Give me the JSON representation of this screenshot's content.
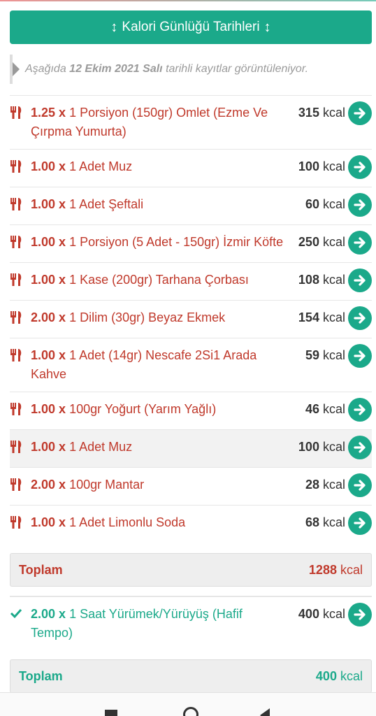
{
  "header": {
    "button_label": "Kalori Günlüğü Tarihleri",
    "arrow_glyph": "↕"
  },
  "notice": {
    "prefix": "Aşağıda",
    "date": "12 Ekim 2021 Salı",
    "suffix": "tarihli kayıtlar görüntüleniyor."
  },
  "foods": [
    {
      "qty": "1.25 x",
      "desc": "1 Porsiyon (150gr) Omlet (Ezme Ve Çırpma Yumurta)",
      "kcal": "315",
      "unit": "kcal"
    },
    {
      "qty": "1.00 x",
      "desc": "1 Adet Muz",
      "kcal": "100",
      "unit": "kcal"
    },
    {
      "qty": "1.00 x",
      "desc": "1 Adet Şeftali",
      "kcal": "60",
      "unit": "kcal"
    },
    {
      "qty": "1.00 x",
      "desc": "1 Porsiyon (5 Adet - 150gr) İzmir Köfte",
      "kcal": "250",
      "unit": "kcal"
    },
    {
      "qty": "1.00 x",
      "desc": "1 Kase (200gr) Tarhana Çorbası",
      "kcal": "108",
      "unit": "kcal"
    },
    {
      "qty": "2.00 x",
      "desc": "1 Dilim (30gr) Beyaz Ekmek",
      "kcal": "154",
      "unit": "kcal"
    },
    {
      "qty": "1.00 x",
      "desc": "1 Adet (14gr) Nescafe 2Si1 Arada Kahve",
      "kcal": "59",
      "unit": "kcal"
    },
    {
      "qty": "1.00 x",
      "desc": "100gr Yoğurt (Yarım Yağlı)",
      "kcal": "46",
      "unit": "kcal"
    },
    {
      "qty": "1.00 x",
      "desc": "1 Adet Muz",
      "kcal": "100",
      "unit": "kcal"
    },
    {
      "qty": "2.00 x",
      "desc": "100gr Mantar",
      "kcal": "28",
      "unit": "kcal"
    },
    {
      "qty": "1.00 x",
      "desc": "1 Adet Limonlu Soda",
      "kcal": "68",
      "unit": "kcal"
    }
  ],
  "food_total": {
    "label": "Toplam",
    "value": "1288",
    "unit": "kcal"
  },
  "activities": [
    {
      "qty": "2.00 x",
      "desc": "1 Saat Yürümek/Yürüyüş (Hafif Tempo)",
      "kcal": "400",
      "unit": "kcal"
    }
  ],
  "activity_total": {
    "label": "Toplam",
    "value": "400",
    "unit": "kcal"
  },
  "colors": {
    "accent": "#1ba98a",
    "food_text": "#c0392b"
  },
  "icons": {
    "food": "fork-knife-icon",
    "activity": "check-icon",
    "go": "arrow-right-circle-icon"
  }
}
